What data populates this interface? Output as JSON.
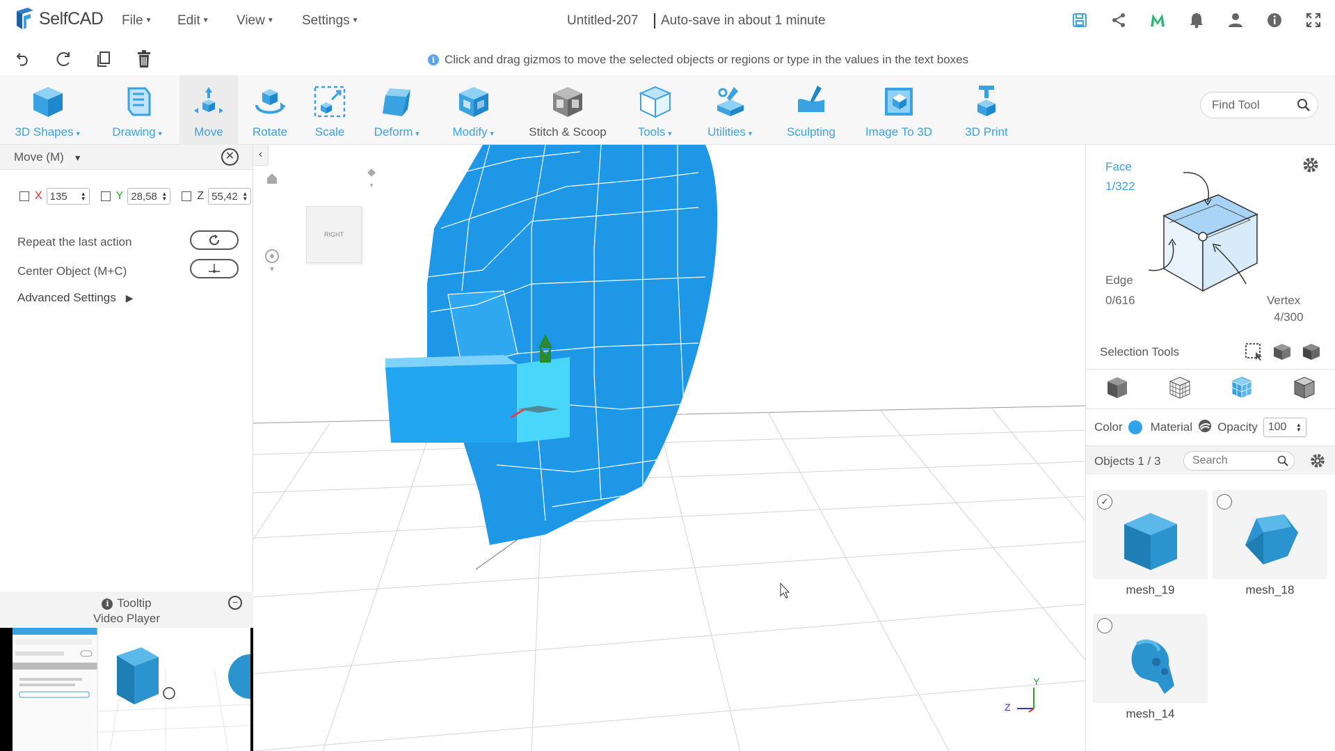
{
  "app": {
    "logo_text": "SelfCAD",
    "menus": [
      {
        "label": "File"
      },
      {
        "label": "Edit"
      },
      {
        "label": "View"
      },
      {
        "label": "Settings"
      }
    ],
    "document_title": "Untitled-207",
    "autosave_text": "Auto-save in about 1 minute"
  },
  "hint": {
    "text": "Click and drag gizmos to move the selected objects or regions or type in the values in the text boxes"
  },
  "toolbar": {
    "tools": [
      {
        "label": "3D Shapes",
        "icon": "cube-icon",
        "dropdown": true
      },
      {
        "label": "Drawing",
        "icon": "drawing-icon",
        "dropdown": true
      },
      {
        "label": "Move",
        "icon": "move-icon",
        "dropdown": false,
        "active": true
      },
      {
        "label": "Rotate",
        "icon": "rotate-icon",
        "dropdown": false
      },
      {
        "label": "Scale",
        "icon": "scale-icon",
        "dropdown": false
      },
      {
        "label": "Deform",
        "icon": "deform-icon",
        "dropdown": true
      },
      {
        "label": "Modify",
        "icon": "modify-icon",
        "dropdown": true
      },
      {
        "label": "Stitch & Scoop",
        "icon": "stitch-scoop-icon",
        "dropdown": false
      },
      {
        "label": "Tools",
        "icon": "tools-icon",
        "dropdown": true
      },
      {
        "label": "Utilities",
        "icon": "utilities-icon",
        "dropdown": true
      },
      {
        "label": "Sculpting",
        "icon": "sculpting-icon",
        "dropdown": false
      },
      {
        "label": "Image To 3D",
        "icon": "image-to-3d-icon",
        "dropdown": false
      },
      {
        "label": "3D Print",
        "icon": "3d-print-icon",
        "dropdown": false
      }
    ],
    "find_placeholder": "Find Tool"
  },
  "move_panel": {
    "title": "Move (M)",
    "x_label": "X",
    "y_label": "Y",
    "z_label": "Z",
    "x_value": "135",
    "y_value": "28,58",
    "z_value": "55,42",
    "repeat_label": "Repeat the last action",
    "center_label": "Center Object (M+C)",
    "advanced_label": "Advanced Settings",
    "tooltip_line1": "Tooltip",
    "tooltip_line2": "Video Player"
  },
  "viewport": {
    "viewcube_face": "RIGHT",
    "axis_y": "Y",
    "axis_z": "Z"
  },
  "selection": {
    "face_label": "Face",
    "face_count": "1/322",
    "edge_label": "Edge",
    "edge_count": "0/616",
    "vertex_label": "Vertex",
    "vertex_count": "4/300",
    "tools_label": "Selection Tools",
    "color_label": "Color",
    "material_label": "Material",
    "opacity_label": "Opacity",
    "opacity_value": "100",
    "accent_color": "#2fa4ea"
  },
  "objects": {
    "count_label": "Objects 1 / 3",
    "search_placeholder": "Search",
    "items": [
      {
        "name": "mesh_19",
        "checked": true
      },
      {
        "name": "mesh_18",
        "checked": false
      },
      {
        "name": "mesh_14",
        "checked": false
      }
    ]
  }
}
